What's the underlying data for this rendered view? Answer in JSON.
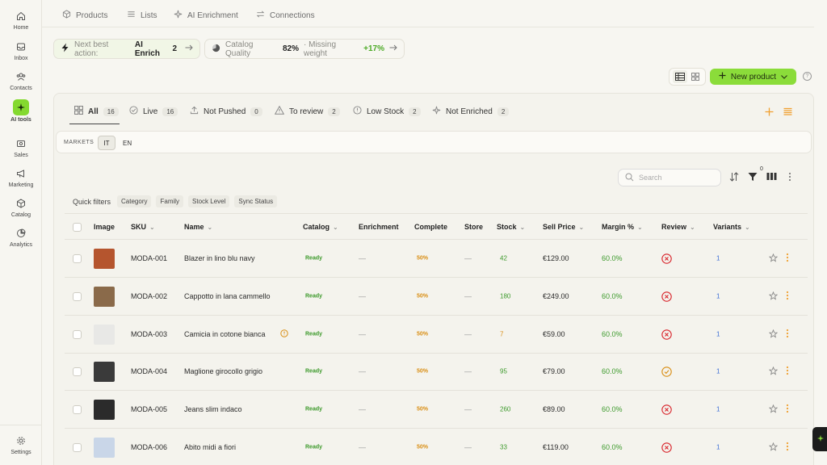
{
  "sidebar": {
    "items": [
      {
        "label": "Home",
        "icon": "home-icon"
      },
      {
        "label": "Inbox",
        "icon": "inbox-icon"
      },
      {
        "label": "Contacts",
        "icon": "contacts-icon"
      },
      {
        "label": "AI tools",
        "icon": "sparkle-icon",
        "active": true
      },
      {
        "label": "Sales",
        "icon": "sales-icon"
      },
      {
        "label": "Marketing",
        "icon": "megaphone-icon"
      },
      {
        "label": "Catalog",
        "icon": "box-icon"
      },
      {
        "label": "Analytics",
        "icon": "pie-chart-icon"
      }
    ],
    "settings": {
      "label": "Settings",
      "icon": "gear-icon"
    }
  },
  "top_tabs": [
    {
      "label": "Products",
      "icon": "cube-icon"
    },
    {
      "label": "Lists",
      "icon": "list-icon"
    },
    {
      "label": "AI Enrichment",
      "icon": "sparkle-icon"
    },
    {
      "label": "Connections",
      "icon": "arrows-icon"
    }
  ],
  "next_action": {
    "prefix": "Next best action:",
    "action": "AI Enrich",
    "count": "2"
  },
  "catalog_quality": {
    "label": "Catalog Quality",
    "value": "82%",
    "missing": "· Missing weight",
    "delta": "+17%"
  },
  "new_product_label": "New product",
  "help_label": "?",
  "filter_tabs": [
    {
      "label": "All",
      "count": "16"
    },
    {
      "label": "Live",
      "count": "16"
    },
    {
      "label": "Not Pushed",
      "count": "0"
    },
    {
      "label": "To review",
      "count": "2"
    },
    {
      "label": "Low Stock",
      "count": "2"
    },
    {
      "label": "Not Enriched",
      "count": "2"
    }
  ],
  "markets": {
    "label": "MARKETS",
    "options": [
      "IT",
      "EN"
    ],
    "selected": "IT"
  },
  "search": {
    "placeholder": "Search"
  },
  "filter_badge": "0",
  "quick_filters": {
    "label": "Quick filters",
    "chips": [
      "Category",
      "Family",
      "Stock Level",
      "Sync Status"
    ]
  },
  "columns": [
    "Image",
    "SKU",
    "Name",
    "Catalog",
    "Enrichment",
    "Complete",
    "Store",
    "Stock",
    "Sell Price",
    "Margin %",
    "Review",
    "Variants"
  ],
  "rows": [
    {
      "sku": "MODA-001",
      "name": "Blazer in lino blu navy",
      "catalog": "Ready",
      "enrichment": "—",
      "complete": "50%",
      "store": "—",
      "stock": "42",
      "stock_level": "ok",
      "price": "€129.00",
      "margin": "60.0%",
      "review": "rejected",
      "variants": "1",
      "warn": false,
      "thumb": "#b5552e"
    },
    {
      "sku": "MODA-002",
      "name": "Cappotto in lana cammello",
      "catalog": "Ready",
      "enrichment": "—",
      "complete": "50%",
      "store": "—",
      "stock": "180",
      "stock_level": "ok",
      "price": "€249.00",
      "margin": "60.0%",
      "review": "rejected",
      "variants": "1",
      "warn": false,
      "thumb": "#8a6a4a"
    },
    {
      "sku": "MODA-003",
      "name": "Camicia in cotone bianca",
      "catalog": "Ready",
      "enrichment": "—",
      "complete": "50%",
      "store": "—",
      "stock": "7",
      "stock_level": "low",
      "price": "€59.00",
      "margin": "60.0%",
      "review": "rejected",
      "variants": "1",
      "warn": true,
      "thumb": "#e8e8e6"
    },
    {
      "sku": "MODA-004",
      "name": "Maglione girocollo grigio",
      "catalog": "Ready",
      "enrichment": "—",
      "complete": "50%",
      "store": "—",
      "stock": "95",
      "stock_level": "ok",
      "price": "€79.00",
      "margin": "60.0%",
      "review": "pending",
      "variants": "1",
      "warn": false,
      "thumb": "#3a3a3a"
    },
    {
      "sku": "MODA-005",
      "name": "Jeans slim indaco",
      "catalog": "Ready",
      "enrichment": "—",
      "complete": "50%",
      "store": "—",
      "stock": "260",
      "stock_level": "ok",
      "price": "€89.00",
      "margin": "60.0%",
      "review": "rejected",
      "variants": "1",
      "warn": false,
      "thumb": "#2b2b2b"
    },
    {
      "sku": "MODA-006",
      "name": "Abito midi a fiori",
      "catalog": "Ready",
      "enrichment": "—",
      "complete": "50%",
      "store": "—",
      "stock": "33",
      "stock_level": "ok",
      "price": "€119.00",
      "margin": "60.0%",
      "review": "rejected",
      "variants": "1",
      "warn": false,
      "thumb": "#c9d6e8"
    }
  ],
  "colors": {
    "accent": "#8bdc3a",
    "ready": "#3d9a2c",
    "warning": "#d98e14",
    "rejected": "#d8232a",
    "link": "#3b6ed6",
    "toolbar_orange": "#f0a030"
  }
}
